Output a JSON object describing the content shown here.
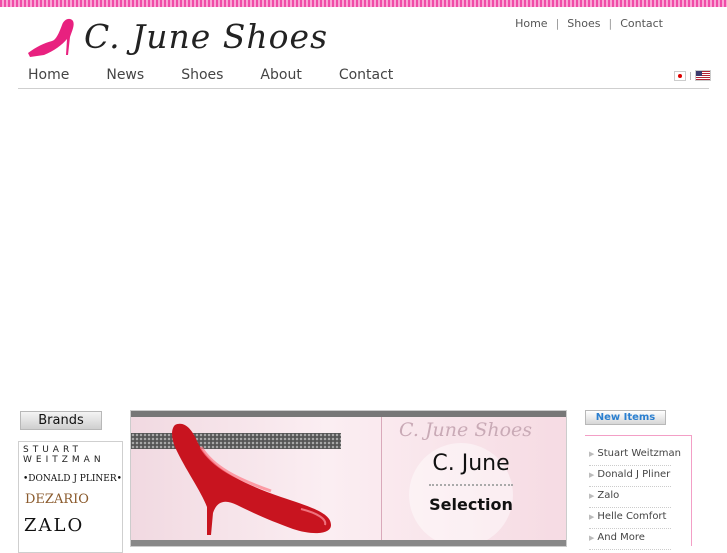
{
  "header": {
    "logo_text": "C. June Shoes",
    "toplinks": [
      "Home",
      "Shoes",
      "Contact"
    ],
    "toplink_sep": "|",
    "flag_sep": "|",
    "brand_color": "#e8217f"
  },
  "nav": {
    "items": [
      "Home",
      "News",
      "Shoes",
      "About",
      "Contact"
    ]
  },
  "brands": {
    "heading": "Brands",
    "stuart": "STUART WEITZMAN",
    "donald": "•DONALD J PLINER•",
    "dezario": "DEZARIO",
    "zalo": "ZALO"
  },
  "banner": {
    "logo": "C. June Shoes",
    "title": "C. June",
    "subtitle": "Selection"
  },
  "new_items": {
    "heading": "New Items",
    "items": [
      "Stuart Weitzman",
      "Donald J Pliner",
      "Zalo",
      "Helle Comfort",
      "And More"
    ]
  }
}
